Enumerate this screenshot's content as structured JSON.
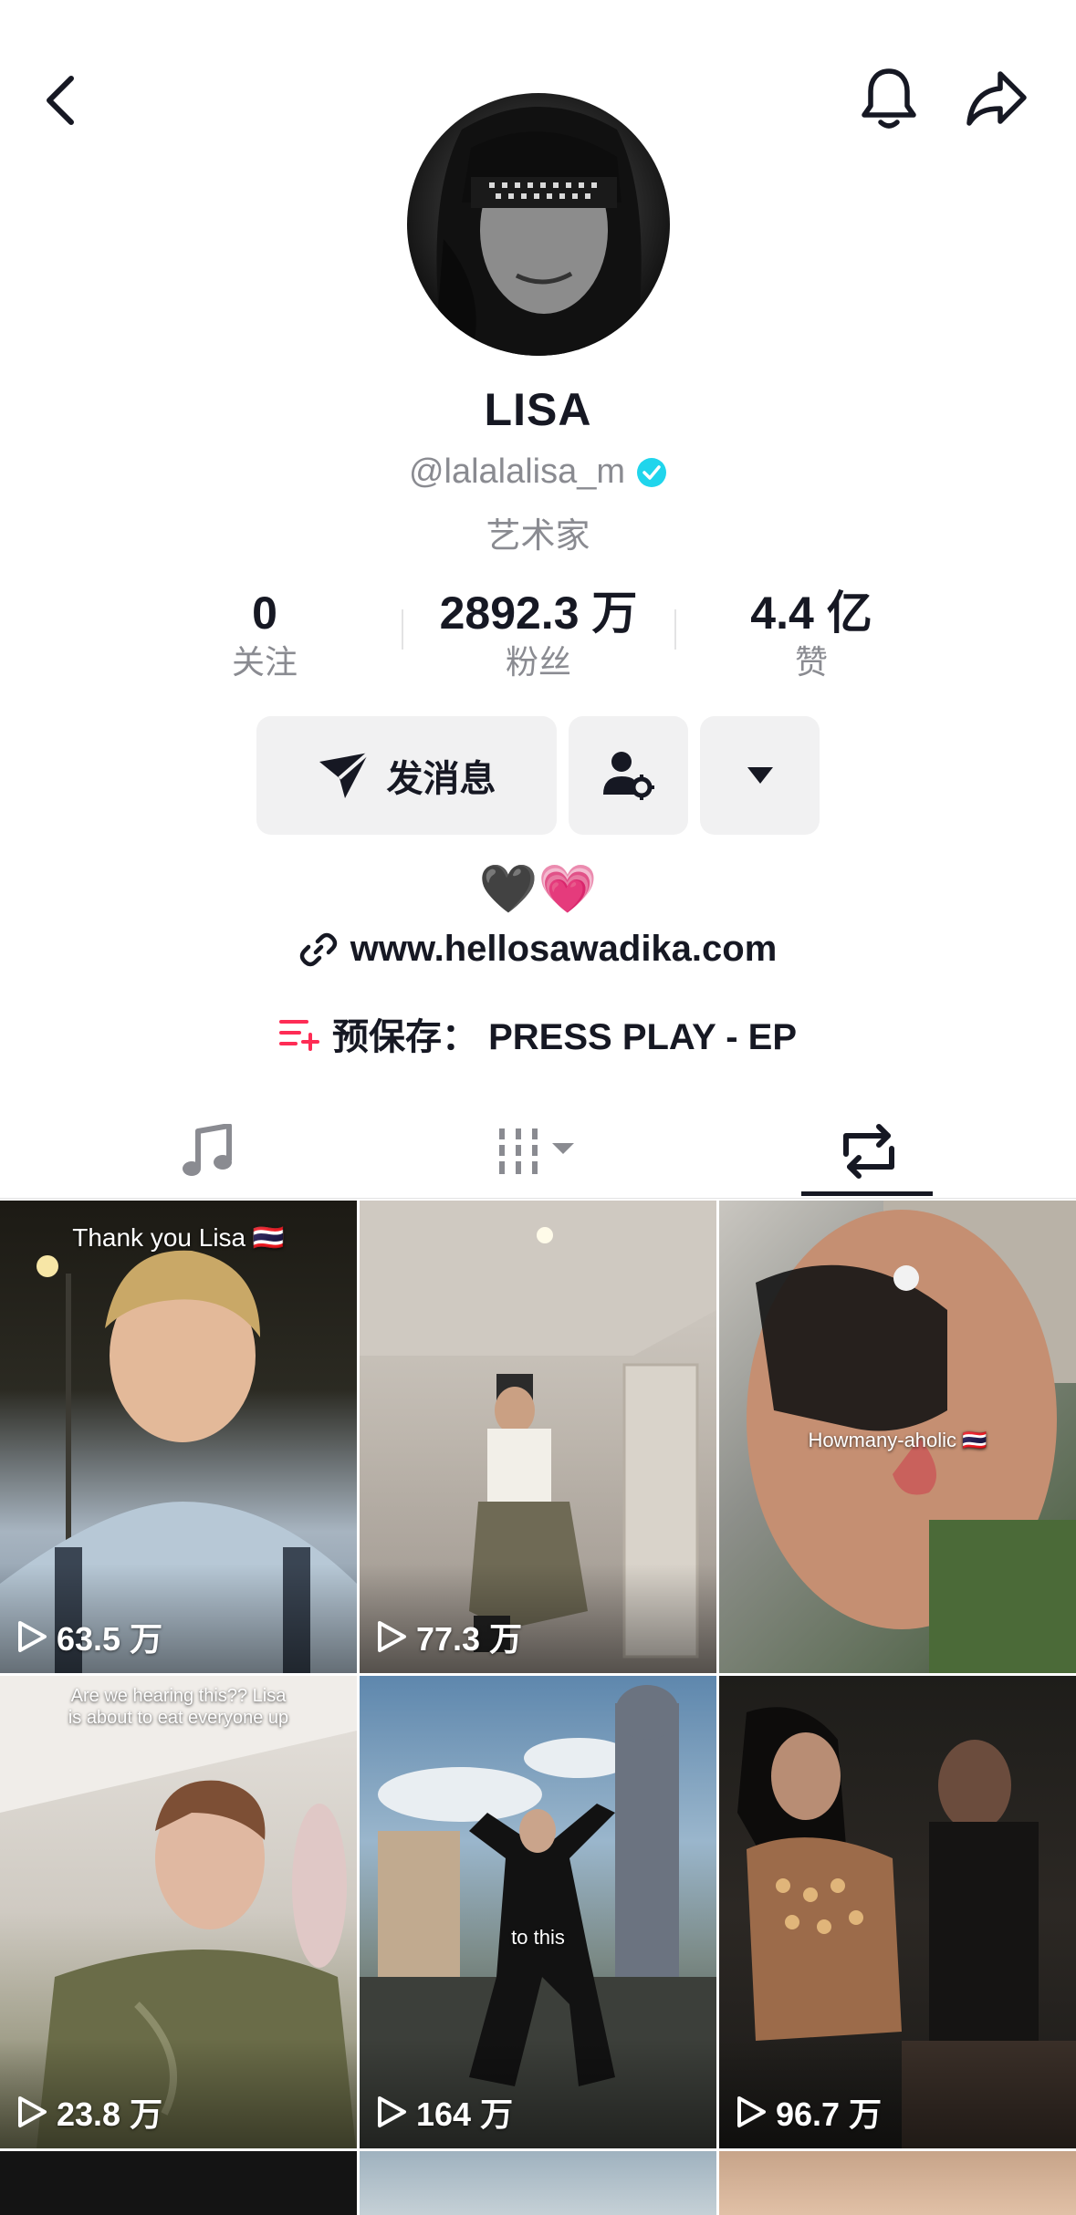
{
  "header": {
    "back_icon": "chevron-left-icon",
    "notify_icon": "bell-icon",
    "share_icon": "share-arrow-icon"
  },
  "profile": {
    "name": "LISA",
    "handle": "@lalalalisa_m",
    "verified": true,
    "role": "艺术家",
    "stats": [
      {
        "value": "0",
        "label": "关注"
      },
      {
        "value": "2892.3 万",
        "label": "粉丝"
      },
      {
        "value": "4.4 亿",
        "label": "赞"
      }
    ],
    "bio": "🖤💗",
    "link": "www.hellosawadika.com",
    "presave": "预保存：  PRESS PLAY - EP"
  },
  "actions": {
    "message_label": "发消息",
    "follow_settings_icon": "user-gear-icon",
    "more_icon": "caret-down-icon"
  },
  "tabs": [
    {
      "icon": "music-note-icon",
      "active": false
    },
    {
      "icon": "columns-filter-icon",
      "active": false
    },
    {
      "icon": "repost-icon",
      "active": true
    }
  ],
  "videos": [
    {
      "views": "63.5 万",
      "caption": "Thank you Lisa 🇹🇭"
    },
    {
      "views": "77.3 万",
      "caption": ""
    },
    {
      "views": "",
      "caption": "Howmany-aholic 🇹🇭"
    },
    {
      "views": "23.8 万",
      "caption": "Are we hearing this?? Lisa\nis about to eat everyone up"
    },
    {
      "views": "164 万",
      "caption": "to this"
    },
    {
      "views": "96.7 万",
      "caption": ""
    }
  ],
  "colors": {
    "text": "#161823",
    "muted": "#8a8b91",
    "button_bg": "#f1f1f2",
    "verified": "#20d5ec",
    "presave_accent": "#fe2c55"
  }
}
